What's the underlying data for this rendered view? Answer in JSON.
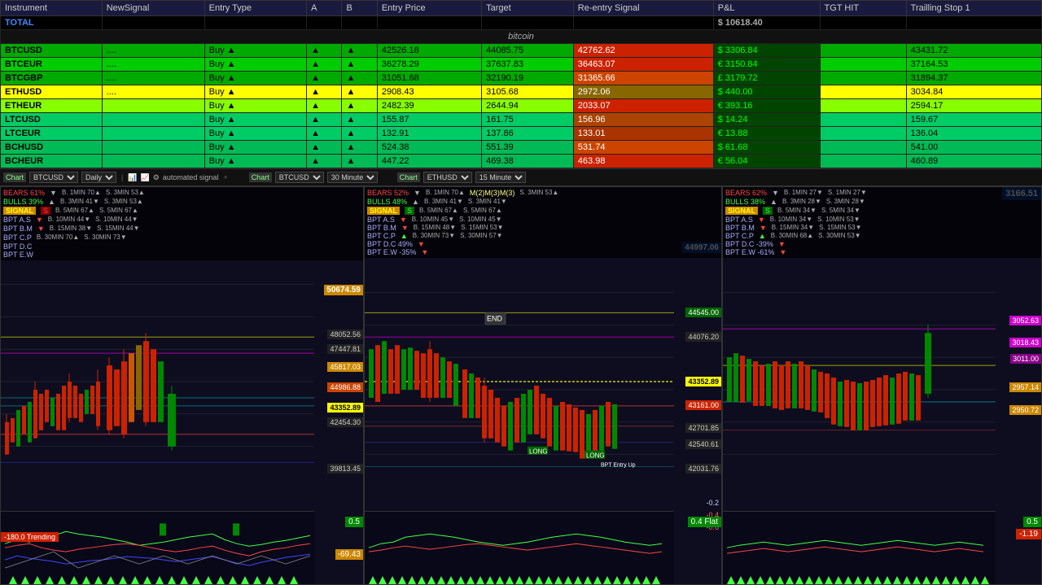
{
  "table": {
    "headers": [
      "Instrument",
      "NewSignal",
      "Entry Type",
      "A",
      "B",
      "Entry Price",
      "Target",
      "Re-entry Signal",
      "P&L",
      "TGT HIT",
      "Trailling Stop 1"
    ],
    "total_row": {
      "instrument": "TOTAL",
      "pnl": "$ 10618.40"
    },
    "section_label": "bitcoin",
    "rows": [
      {
        "instrument": "BTCUSD",
        "signal": "....",
        "entry_type": "Buy",
        "a": "▲",
        "b": "▲",
        "entry_price": "42526.18",
        "target": "44085.75",
        "re_entry": "42762.62",
        "pnl": "$ 3306.84",
        "tgt_hit": "",
        "trailing": "43431.72",
        "row_class": "row-btcusd"
      },
      {
        "instrument": "BTCEUR",
        "signal": "....",
        "entry_type": "Buy",
        "a": "▲",
        "b": "▲",
        "entry_price": "36278.29",
        "target": "37637.83",
        "re_entry": "36463.07",
        "pnl": "€ 3150.84",
        "tgt_hit": "",
        "trailing": "37164.53",
        "row_class": "row-btceur"
      },
      {
        "instrument": "BTCGBP",
        "signal": "....",
        "entry_type": "Buy",
        "a": "▲",
        "b": "▲",
        "entry_price": "31051.68",
        "target": "32190.19",
        "re_entry": "31365.66",
        "pnl": "£ 3179.72",
        "tgt_hit": "",
        "trailing": "31894.37",
        "row_class": "row-btcgbp"
      },
      {
        "instrument": "ETHUSD",
        "signal": "....",
        "entry_type": "Buy",
        "a": "▲",
        "b": "▲",
        "entry_price": "2908.43",
        "target": "3105.68",
        "re_entry": "2972.06",
        "pnl": "$ 440.00",
        "tgt_hit": "",
        "trailing": "3034.84",
        "row_class": "row-ethusd"
      },
      {
        "instrument": "ETHEUR",
        "signal": "",
        "entry_type": "Buy",
        "a": "▲",
        "b": "▲",
        "entry_price": "2482.39",
        "target": "2644.94",
        "re_entry": "2033.07",
        "pnl": "€ 393.16",
        "tgt_hit": "",
        "trailing": "2594.17",
        "row_class": "row-etheur"
      },
      {
        "instrument": "LTCUSD",
        "signal": "",
        "entry_type": "Buy",
        "a": "▲",
        "b": "▲",
        "entry_price": "155.87",
        "target": "161.75",
        "re_entry": "156.96",
        "pnl": "$ 14.24",
        "tgt_hit": "",
        "trailing": "159.67",
        "row_class": "row-ltcusd"
      },
      {
        "instrument": "LTCEUR",
        "signal": "",
        "entry_type": "Buy",
        "a": "▲",
        "b": "▲",
        "entry_price": "132.91",
        "target": "137.86",
        "re_entry": "133.01",
        "pnl": "€ 13.88",
        "tgt_hit": "",
        "trailing": "136.04",
        "row_class": "row-ltceur"
      },
      {
        "instrument": "BCHUSD",
        "signal": "",
        "entry_type": "Buy",
        "a": "▲",
        "b": "▲",
        "entry_price": "524.38",
        "target": "551.39",
        "re_entry": "531.74",
        "pnl": "$ 61.68",
        "tgt_hit": "",
        "trailing": "541.00",
        "row_class": "row-bchusd"
      },
      {
        "instrument": "BCHEUR",
        "signal": "",
        "entry_type": "Buy",
        "a": "▲",
        "b": "▲",
        "entry_price": "447.22",
        "target": "469.38",
        "re_entry": "463.98",
        "pnl": "€ 56.04",
        "tgt_hit": "",
        "trailing": "460.89",
        "row_class": "row-bcheur"
      }
    ]
  },
  "charts": {
    "left": {
      "symbol": "BTCUSD",
      "timeframe": "Daily",
      "bears": "61%",
      "bulls": "39%",
      "signal": "S",
      "prices": {
        "main": "50674.59",
        "p1": "48052.56",
        "p2": "47447.81",
        "p3": "45817.03",
        "p4": "44986.88",
        "p5": "43352.89",
        "p6": "42454.30",
        "p7": "39813.45"
      },
      "osc_value": "0.5",
      "trending": "-180.0 Trending",
      "trending_val": "-69.43"
    },
    "mid": {
      "symbol": "BTCUSD",
      "timeframe": "30 Minute",
      "bears": "52%",
      "bulls": "48%",
      "price_top": "44997.06",
      "prices": {
        "p1": "44545.00",
        "p2": "44076.20",
        "p3": "43352.89",
        "p4": "43161.00",
        "p5": "42701.85",
        "p6": "42540.61",
        "p7": "42031.76"
      },
      "neg_vals": [
        "-0.2",
        "-0.4",
        "-0.6"
      ],
      "osc_val": "0.4 Flat"
    },
    "right": {
      "symbol": "ETHUSD",
      "timeframe": "15 Minute",
      "bears": "62%",
      "bulls": "38%",
      "price_header": "3166.51",
      "prices": {
        "p1": "3052.63",
        "p2": "3018.43",
        "p3": "3011.00",
        "p4": "2957.14",
        "p5": "2950.72"
      },
      "osc_val": "0.5",
      "osc_val2": "-1.19"
    }
  },
  "signals": {
    "left": {
      "bears_pct": "BEARS 61%",
      "bulls_pct": "BULLS 39%",
      "signal": "SIGNAL",
      "bpta_s": "BPT A.S",
      "bptb_m": "BPT B.M",
      "bptc_p": "BPT C.P",
      "bptd_c": "BPT D.C",
      "bpte_w": "BPT E.W",
      "b1min": "B. 1MIN 70▲",
      "b3min1": "B. 3MIN 41▼",
      "b5min": "B. 5MIN 67▲",
      "b10min": "B. 10MIN 44▼",
      "b15min": "B. 15MIN 38▼",
      "b30min": "B. 30MIN 70▲",
      "s3min1": "S. 3MIN 53▲",
      "s3min2": "S. 3MIN 53▲",
      "s5min": "S. 5MIN 67▲",
      "s10min": "S. 10MIN 44▼",
      "s15min": "S. 15MIN 44▼",
      "s30min": "S. 30MIN 73▼"
    },
    "mid": {
      "bears_pct": "BEARS 52%",
      "bulls_pct": "BULLS 48%",
      "signal": "SIGNAL",
      "b1min": "B. 1MIN 70▲",
      "b3min": "B. 3MIN 41▼",
      "b5min": "B. 5MIN 67▲",
      "b10min": "B. 10MIN 45▼",
      "b15min": "B. 15MIN 48▼",
      "b30min": "B. 30MIN 73▼",
      "s3min1": "S. 3MIN 53▲",
      "s3min2": "S. 3MIN 41▼",
      "s5min": "S. 5MIN 67▲",
      "s10min": "S. 10MIN 45▼",
      "s15min": "S. 15MIN 53▼",
      "s30min": "S. 30MIN 57▼",
      "m2m3": "M(2)M(3)M(3)"
    },
    "right": {
      "bears_pct": "BEARS 62%",
      "bulls_pct": "BULLS 38%",
      "signal": "SIGNAL",
      "b1min": "B. 1MIN 27▼",
      "b3min": "B. 3MIN 28▼",
      "b5min": "B. 5MIN 34▼",
      "b10min": "B. 10MIN 34▼",
      "b15min": "B. 15MIN 34▼",
      "b30min": "B. 30MIN 68▲",
      "s1min": "S. 1MIN 27▼",
      "s3min": "S. 3MIN 28▼",
      "s5min": "S. 5MIN 34▼",
      "s10min": "S. 10MIN 53▼",
      "s15min": "S. 15MIN 53▼",
      "s30min": "S. 30MIN 53▼"
    }
  }
}
